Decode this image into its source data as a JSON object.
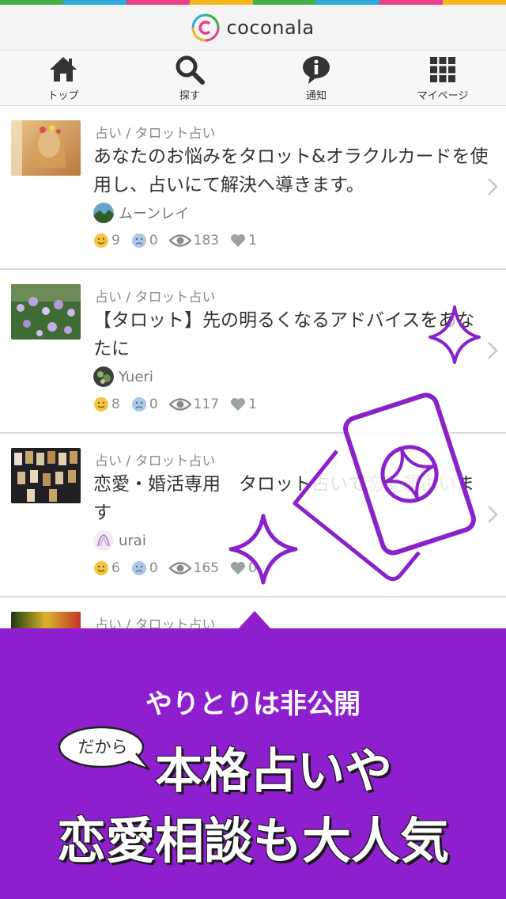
{
  "colors": {
    "stripe": [
      "#43b245",
      "#2fa8e0",
      "#e8418b",
      "#f3b61f",
      "#43b245",
      "#2fa8e0",
      "#e8418b",
      "#f3b61f"
    ],
    "accent_purple": "#8e1fcf",
    "outline_purple": "#8a22c9"
  },
  "header": {
    "logo_text": "coconala"
  },
  "nav": {
    "items": [
      {
        "label": "トップ",
        "icon": "home-icon"
      },
      {
        "label": "探す",
        "icon": "search-icon"
      },
      {
        "label": "通知",
        "icon": "info-icon"
      },
      {
        "label": "マイページ",
        "icon": "grid-icon"
      }
    ]
  },
  "listings": [
    {
      "category": "占い / タロット占い",
      "title": "あなたのお悩みをタロット&オラクルカードを使用し、占いにて解決へ導きます。",
      "user": "ムーンレイ",
      "smile": "9",
      "sad": "0",
      "views": "183",
      "likes": "1"
    },
    {
      "category": "占い / タロット占い",
      "title": "【タロット】先の明るくなるアドバイスをあなたに",
      "user": "Yueri",
      "smile": "8",
      "sad": "0",
      "views": "117",
      "likes": "1"
    },
    {
      "category": "占い / タロット占い",
      "title": "恋愛・婚活専用　タロット占いで恋愛運占います",
      "user": "urai",
      "smile": "6",
      "sad": "0",
      "views": "165",
      "likes": "0"
    },
    {
      "category": "占い / タロット占い"
    }
  ],
  "banner": {
    "line1": "やりとりは非公開",
    "bubble": "だから",
    "line2": "本格占いや",
    "line3": "恋愛相談も大人気"
  }
}
